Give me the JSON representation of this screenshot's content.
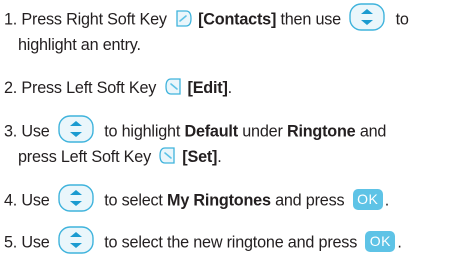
{
  "steps": [
    {
      "number": "1.",
      "pre": "Press Right Soft Key",
      "bracket": "[Contacts]",
      "mid": "then use",
      "post": "to",
      "line2": "highlight an entry."
    },
    {
      "number": "2.",
      "pre": "Press Left Soft Key",
      "bracket": "[Edit]",
      "post": "."
    },
    {
      "number": "3.",
      "pre": "Use",
      "mid": "to highlight",
      "bold1": "Default",
      "mid2": "under",
      "bold2": "Ringtone",
      "post": "and",
      "line2_pre": "press Left Soft Key",
      "line2_bracket": "[Set]",
      "line2_post": "."
    },
    {
      "number": "4.",
      "pre": "Use",
      "mid": "to select",
      "bold1": "My Ringtones",
      "post": "and press",
      "end": "."
    },
    {
      "number": "5.",
      "pre": "Use",
      "mid": "to select the new ringtone and press",
      "end": "."
    }
  ],
  "icons": {
    "right_soft_key": "right-soft-key-icon",
    "left_soft_key": "left-soft-key-icon",
    "nav_key": "navigation-key-icon",
    "ok_key_label": "OK"
  },
  "colors": {
    "text": "#231f20",
    "icon_blue": "#5ec3e6",
    "icon_outline": "#3fb3dc"
  }
}
